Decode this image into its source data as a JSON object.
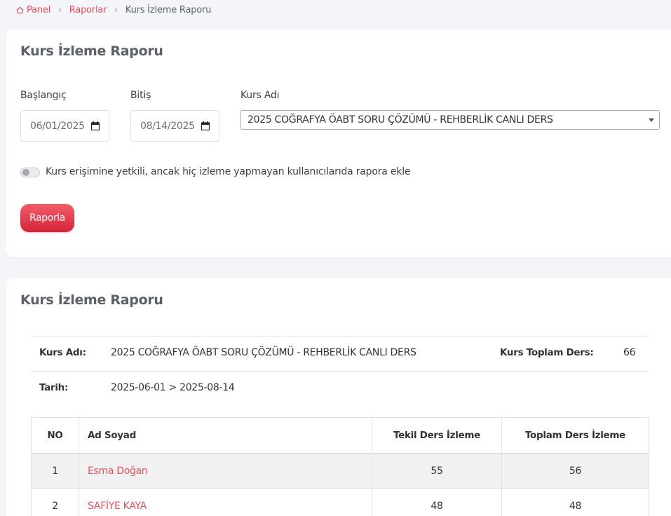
{
  "breadcrumb": {
    "home": "Panel",
    "section": "Raporlar",
    "current": "Kurs İzleme Raporu"
  },
  "filter_card": {
    "title": "Kurs İzleme Raporu",
    "start_label": "Başlangıç",
    "start_value": "06/01/2025",
    "end_label": "Bitiş",
    "end_value": "08/14/2025",
    "course_label": "Kurs Adı",
    "course_value": "2025 COĞRAFYA ÖABT SORU ÇÖZÜMÜ - REHBERLİK CANLI DERS",
    "toggle_label": "Kurs erişimine yetkili, ancak hiç izleme yapmayan kullanıcılarıda rapora ekle",
    "toggle_on": false,
    "submit_label": "Raporla"
  },
  "report_card": {
    "title": "Kurs İzleme Raporu",
    "course_key": "Kurs Adı:",
    "course_value": "2025 COĞRAFYA ÖABT SORU ÇÖZÜMÜ - REHBERLİK CANLI DERS",
    "total_key": "Kurs Toplam Ders:",
    "total_value": "66",
    "date_key": "Tarih:",
    "date_value": "2025-06-01 > 2025-08-14",
    "table": {
      "headers": [
        "NO",
        "Ad Soyad",
        "Tekil Ders İzleme",
        "Toplam Ders İzleme"
      ],
      "rows": [
        {
          "no": "1",
          "name": "Esma Doğan",
          "unique": "55",
          "total": "56"
        },
        {
          "no": "2",
          "name": "SAFİYE KAYA",
          "unique": "48",
          "total": "48"
        }
      ]
    }
  },
  "colors": {
    "accent": "#e5525d",
    "button_top": "#f25d68",
    "button_bottom": "#d5243a",
    "page_bg": "#f4f5f8"
  },
  "icons": [
    "home-icon",
    "chevron-right-icon",
    "calendar-icon",
    "dropdown-caret-icon"
  ]
}
